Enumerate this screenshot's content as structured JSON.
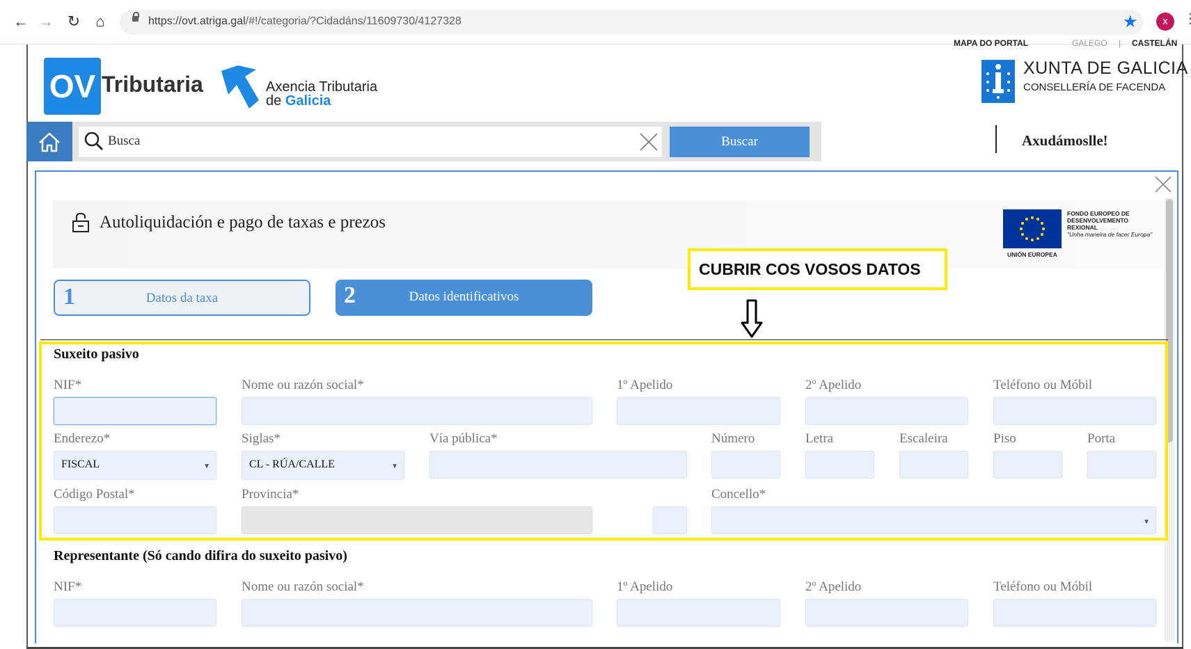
{
  "browser": {
    "url_host": "https://ovt.atriga.gal",
    "url_path": "/#!/categoria/?Cidadáns/11609730/4127328",
    "avatar_letter": "x"
  },
  "top_links": {
    "portal_map": "MAPA DO PORTAL",
    "galician": "GALEGO",
    "separator": "|",
    "spanish": "CASTELÁN"
  },
  "header": {
    "ov": "OV",
    "tributaria": "Tributaria",
    "agency_line1": "Axencia Tributaria",
    "agency_de": "de",
    "agency_galicia": "Galicia",
    "xunta_title": "XUNTA DE GALICIA",
    "xunta_sub": "CONSELLERÍA DE FACENDA"
  },
  "search": {
    "placeholder": "Busca",
    "button": "Buscar",
    "help": "Axudámoslle!"
  },
  "modal": {
    "title": "Autoliquidación e pago de taxas e prezos",
    "eu_text_1": "FONDO EUROPEO DE",
    "eu_text_2": "DESENVOLVEMENTO",
    "eu_text_3": "REXIONAL",
    "eu_text_4": "\"Unha maneira de facer Europa\"",
    "eu_caption": "UNIÓN EUROPEA",
    "annotation": "CUBRIR COS VOSOS DATOS",
    "steps": [
      {
        "num": "1",
        "label": "Datos da taxa"
      },
      {
        "num": "2",
        "label": "Datos identificativos"
      }
    ]
  },
  "taxpayer": {
    "heading": "Suxeito pasivo",
    "nif": "NIF*",
    "name": "Nome ou razón social*",
    "surname1": "1º Apelido",
    "surname2": "2º Apelido",
    "phone": "Teléfono ou Móbil",
    "address": "Enderezo*",
    "address_value": "FISCAL",
    "acronym": "Siglas*",
    "acronym_value": "CL - RÚA/CALLE",
    "street": "Vía pública*",
    "number": "Número",
    "letter": "Letra",
    "stair": "Escaleira",
    "floor": "Piso",
    "door": "Porta",
    "postal": "Código Postal*",
    "province": "Provincia*",
    "council": "Concello*"
  },
  "representative": {
    "heading": "Representante (Só cando difira do suxeito pasivo)",
    "nif": "NIF*",
    "name": "Nome ou razón social*",
    "surname1": "1º Apelido",
    "surname2": "2º Apelido",
    "phone": "Teléfono ou Móbil"
  }
}
